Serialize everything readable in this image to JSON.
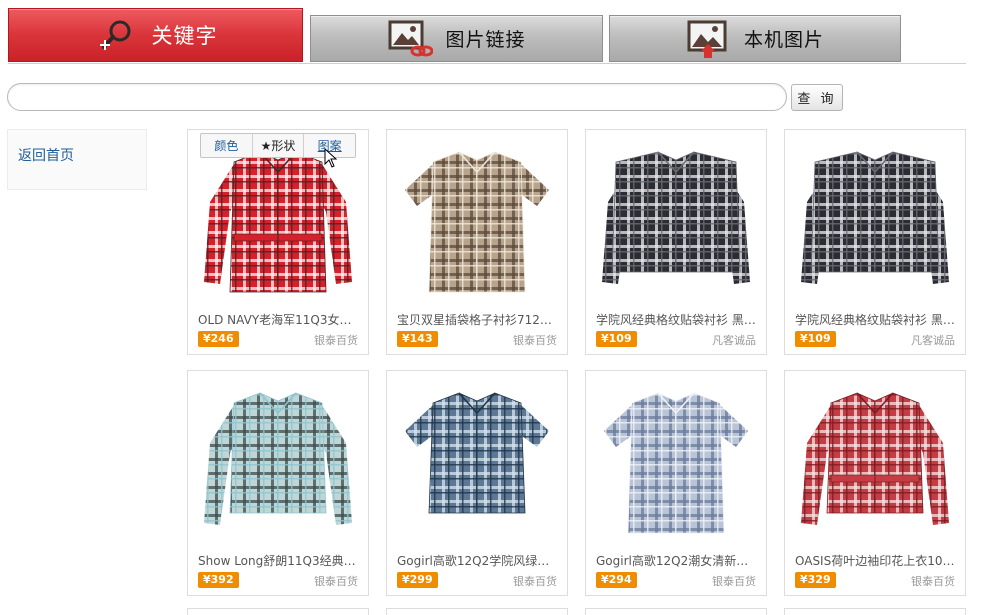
{
  "tabs": [
    {
      "label": "关键字",
      "icon": "magnifier-icon",
      "active": true
    },
    {
      "label": "图片链接",
      "icon": "image-link-icon",
      "active": false
    },
    {
      "label": "本机图片",
      "icon": "image-upload-icon",
      "active": false
    }
  ],
  "search": {
    "value": "",
    "button_label": "查 询"
  },
  "sidebar": {
    "home_link": "返回首页"
  },
  "filters": {
    "color": "颜色",
    "shape": "★形状",
    "pattern": "图案"
  },
  "colors": {
    "price_badge": "#f08c00",
    "active_tab": "#d9353b",
    "link": "#1f5d9a"
  },
  "products": [
    {
      "title": "OLD NAVY老海军11Q3女…",
      "price": "¥246",
      "store": "银泰百货",
      "garment": "long-plaid-red"
    },
    {
      "title": "宝贝双星插袋格子衬衫712…",
      "price": "¥143",
      "store": "银泰百货",
      "garment": "plaid-brown-dress"
    },
    {
      "title": "学院风经典格纹贴袋衬衫 黑…",
      "price": "¥109",
      "store": "凡客诚品",
      "garment": "plaid-black"
    },
    {
      "title": "学院风经典格纹贴袋衬衫 黑…",
      "price": "¥109",
      "store": "凡客诚品",
      "garment": "plaid-black"
    },
    {
      "title": "Show Long舒朗11Q3经典…",
      "price": "¥392",
      "store": "银泰百货",
      "garment": "print-mint"
    },
    {
      "title": "Gogirl高歌12Q2学院风绿格…",
      "price": "¥299",
      "store": "银泰百货",
      "garment": "plaid-blue"
    },
    {
      "title": "Gogirl高歌12Q2潮女清新蓝…",
      "price": "¥294",
      "store": "银泰百货",
      "garment": "ruffle-lightblue"
    },
    {
      "title": "OASIS荷叶边袖印花上衣10…",
      "price": "¥329",
      "store": "银泰百货",
      "garment": "print-red"
    }
  ]
}
